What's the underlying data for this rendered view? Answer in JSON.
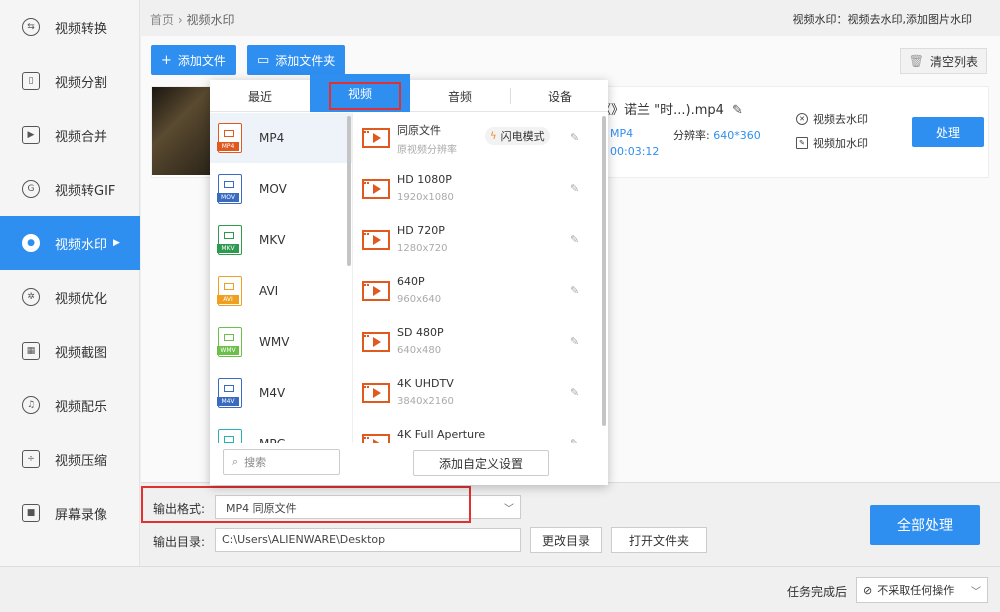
{
  "sidebar": {
    "items": [
      {
        "label": "视频转换",
        "icon": "convert-icon",
        "glyph": "⇆"
      },
      {
        "label": "视频分割",
        "icon": "split-icon",
        "glyph": "▯"
      },
      {
        "label": "视频合并",
        "icon": "merge-icon",
        "glyph": "▶"
      },
      {
        "label": "视频转GIF",
        "icon": "gif-icon",
        "glyph": "G"
      },
      {
        "label": "视频水印",
        "icon": "watermark-icon",
        "glyph": "●"
      },
      {
        "label": "视频优化",
        "icon": "optimize-icon",
        "glyph": "✲"
      },
      {
        "label": "视频截图",
        "icon": "screenshot-icon",
        "glyph": "▦"
      },
      {
        "label": "视频配乐",
        "icon": "music-icon",
        "glyph": "♫"
      },
      {
        "label": "视频压缩",
        "icon": "compress-icon",
        "glyph": "÷"
      },
      {
        "label": "屏幕录像",
        "icon": "record-icon",
        "glyph": "■"
      }
    ],
    "active_index": 4,
    "accent": "#2e8ff0"
  },
  "header": {
    "breadcrumb_home": "首页",
    "breadcrumb_sep": "›",
    "breadcrumb_current": "视频水印",
    "description": "视频水印：视频去水印,添加图片水印"
  },
  "toolbar": {
    "add_file": "添加文件",
    "add_folder": "添加文件夹",
    "clear_list": "清空列表"
  },
  "file": {
    "name": "《》诺兰 \"时...).mp4",
    "format": "MP4",
    "duration": "00:03:12",
    "resolution_label": "分辨率:",
    "resolution_value": "640*360",
    "remove_watermark": "视频去水印",
    "add_watermark": "视频加水印",
    "process": "处理"
  },
  "popup": {
    "tabs": [
      "最近",
      "视频",
      "音频",
      "设备"
    ],
    "active_tab": 1,
    "formats": [
      "MP4",
      "MOV",
      "MKV",
      "AVI",
      "WMV",
      "M4V",
      "MPG"
    ],
    "format_colors": [
      "#e05a20",
      "#3a6bc0",
      "#2e9a50",
      "#f0a020",
      "#6cc04a",
      "#3a6bc0",
      "#2ab0b0"
    ],
    "selected_format": 0,
    "presets": [
      {
        "name": "同原文件",
        "sub": "原视频分辨率"
      },
      {
        "name": "HD 1080P",
        "sub": "1920x1080"
      },
      {
        "name": "HD 720P",
        "sub": "1280x720"
      },
      {
        "name": "640P",
        "sub": "960x640"
      },
      {
        "name": "SD 480P",
        "sub": "640x480"
      },
      {
        "name": "4K UHDTV",
        "sub": "3840x2160"
      },
      {
        "name": "4K Full Aperture",
        "sub": ""
      }
    ],
    "flash_mode": "闪电模式",
    "search_placeholder": "搜索",
    "add_custom": "添加自定义设置"
  },
  "output": {
    "format_label": "输出格式:",
    "format_value": "MP4   同原文件",
    "dir_label": "输出目录:",
    "dir_value": "C:\\Users\\ALIENWARE\\Desktop",
    "change_dir": "更改目录",
    "open_folder": "打开文件夹",
    "process_all": "全部处理"
  },
  "footer": {
    "after_label": "任务完成后",
    "after_value": "不采取任何操作"
  }
}
